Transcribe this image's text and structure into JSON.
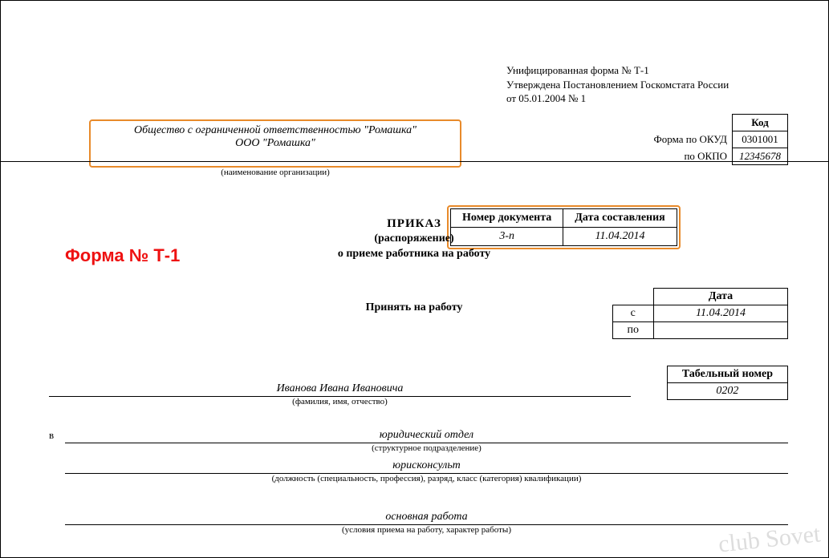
{
  "form_header": {
    "line1": "Унифицированная форма № Т-1",
    "line2": "Утверждена Постановлением Госкомстата России",
    "line3": "от 05.01.2004 № 1"
  },
  "org": {
    "full": "Общество с ограниченной ответственностью \"Ромашка\"",
    "short": "ООО \"Ромашка\"",
    "caption": "(наименование организации)"
  },
  "codes": {
    "kod_header": "Код",
    "okud_label": "Форма по ОКУД",
    "okud_value": "0301001",
    "okpo_label": "по ОКПО",
    "okpo_value": "12345678"
  },
  "docnum": {
    "num_header": "Номер документа",
    "date_header": "Дата составления",
    "num_value": "3-п",
    "date_value": "11.04.2014"
  },
  "title": {
    "prikaz": "ПРИКАЗ",
    "rasp": "(распоряжение)",
    "about": "о приеме работника на работу"
  },
  "annotation": "Форма № Т-1",
  "accept_label": "Принять на работу",
  "dates": {
    "header": "Дата",
    "from_label": "с",
    "from_value": "11.04.2014",
    "to_label": "по",
    "to_value": ""
  },
  "tabel": {
    "header": "Табельный номер",
    "value": "0202"
  },
  "fio": {
    "value": "Иванова Ивана Ивановича",
    "caption": "(фамилия, имя, отчество)"
  },
  "v_label": "в",
  "dept": {
    "value": "юридический отдел",
    "caption": "(структурное подразделение)"
  },
  "position": {
    "value": "юрисконсульт",
    "caption": "(должность (специальность, профессия), разряд, класс (категория) квалификации)"
  },
  "worktype": {
    "value": "основная работа",
    "caption": "(условия приема на работу, характер работы)"
  },
  "watermark": "club Sovet"
}
